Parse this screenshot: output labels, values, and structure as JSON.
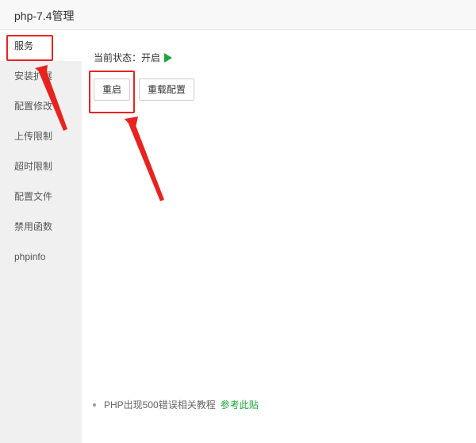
{
  "window": {
    "title": "php-7.4管理"
  },
  "sidebar": {
    "items": [
      {
        "label": "服务",
        "active": true
      },
      {
        "label": "安装扩展"
      },
      {
        "label": "配置修改"
      },
      {
        "label": "上传限制"
      },
      {
        "label": "超时限制"
      },
      {
        "label": "配置文件"
      },
      {
        "label": "禁用函数"
      },
      {
        "label": "phpinfo"
      }
    ]
  },
  "main": {
    "status_label": "当前状态：开启",
    "status_color": "#20a53a",
    "buttons": {
      "restart": "重启",
      "reload": "重载配置"
    },
    "tip": {
      "text": "PHP出现500错误相关教程",
      "link": "参考此贴",
      "link_color": "#20a53a"
    }
  },
  "annotations": {
    "color": "#e8231f"
  }
}
